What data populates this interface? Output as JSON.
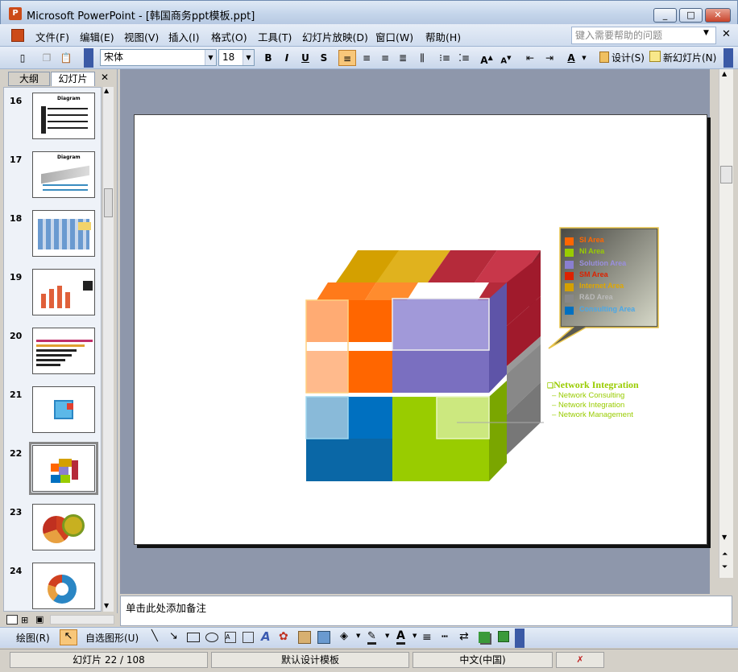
{
  "window": {
    "title": "Microsoft PowerPoint - [韩国商务ppt模板.ppt]",
    "app_icon_glyph": "P",
    "min": "_",
    "max": "□",
    "close": "✕"
  },
  "menu": [
    "文件(F)",
    "编辑(E)",
    "视图(V)",
    "插入(I)",
    "格式(O)",
    "工具(T)",
    "幻灯片放映(D)",
    "窗口(W)",
    "帮助(H)"
  ],
  "help_box": {
    "placeholder": "键入需要帮助的问题"
  },
  "toolbar": {
    "font_name": "宋体",
    "font_size": "18",
    "bold": "B",
    "italic": "I",
    "underline": "U",
    "shadow": "S",
    "design": "设计(S)",
    "new_slide": "新幻灯片(N)"
  },
  "tabs": {
    "outline": "大纲",
    "slides": "幻灯片",
    "close": "✕"
  },
  "slide_thumbs": [
    {
      "num": "16",
      "title": "Diagram"
    },
    {
      "num": "17",
      "title": "Diagram"
    },
    {
      "num": "18",
      "title": ""
    },
    {
      "num": "19",
      "title": ""
    },
    {
      "num": "20",
      "title": ""
    },
    {
      "num": "21",
      "title": ""
    },
    {
      "num": "22",
      "title": ""
    },
    {
      "num": "23",
      "title": ""
    },
    {
      "num": "24",
      "title": ""
    }
  ],
  "slide": {
    "legend": [
      {
        "label": "SI Area",
        "color": "#ff6600"
      },
      {
        "label": "NI Area",
        "color": "#99cc00"
      },
      {
        "label": "Solution Area",
        "color": "#8a7fd0"
      },
      {
        "label": "SM Area",
        "color": "#dd2200"
      },
      {
        "label": "Internet Area",
        "color": "#d4a000"
      },
      {
        "label": "R&D Area",
        "color": "#888888"
      },
      {
        "label": "Consulting Area",
        "color": "#0070c0"
      }
    ],
    "callout_title": "Network Integration",
    "callout_items": [
      "Network Consulting",
      "Network Integration",
      "Network Management"
    ]
  },
  "notes_placeholder": "单击此处添加备注",
  "drawbar": {
    "draw": "绘图(R)",
    "autoshapes": "自选图形(U)"
  },
  "status": {
    "slide": "幻灯片 22 / 108",
    "design": "默认设计模板",
    "lang": "中文(中国)"
  }
}
